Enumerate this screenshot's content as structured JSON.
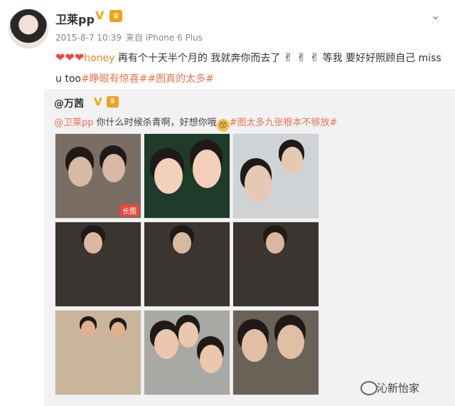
{
  "post": {
    "author": "卫莱pp",
    "verified_mark": "V",
    "vip_mark": "♛",
    "timestamp": "2015-8-7 10:39",
    "source": "来自 iPhone 6 Plus",
    "text_part1": "honey",
    "text_part2": " 再有个十天半个月的 我就奔你而去了",
    "text_part3": " 等我 要好好照顾自己",
    "text_part4": "        miss u too",
    "hashtag1": "#睁眼有惊喜#",
    "hashtag2": "#图真的太多#",
    "hearts": "❤❤❤",
    "victory_emojis": "✌ ✌ ✌",
    "more_icon": "chevron-down-icon"
  },
  "repost": {
    "author": "@万茜",
    "verified_mark": "V",
    "vip_mark": "♛",
    "mention": "@卫莱pp",
    "text": " 你什么时候杀青啊，好想你哦",
    "emoji": "😚",
    "hashtag": "#图太多九张根本不够放#",
    "long_image_tag": "长图",
    "photos": [
      {
        "bg": "#7a6e64",
        "accent": "#d8b9a3"
      },
      {
        "bg": "#1e3b2b",
        "accent": "#f3d0b9"
      },
      {
        "bg": "#cfd3d6",
        "accent": "#e7c9b3"
      },
      {
        "bg": "#3a3531",
        "accent": "#d9b89f"
      },
      {
        "bg": "#3a3531",
        "accent": "#d9b89f"
      },
      {
        "bg": "#3a3531",
        "accent": "#d9b89f"
      },
      {
        "bg": "#c9b59c",
        "accent": "#e0b08f"
      },
      {
        "bg": "#a8a9a4",
        "accent": "#ebc7ad"
      },
      {
        "bg": "#6a6257",
        "accent": "#e2bea4"
      }
    ]
  },
  "watermark": {
    "text": "沁新怡家",
    "icon": "wechat-icon"
  }
}
